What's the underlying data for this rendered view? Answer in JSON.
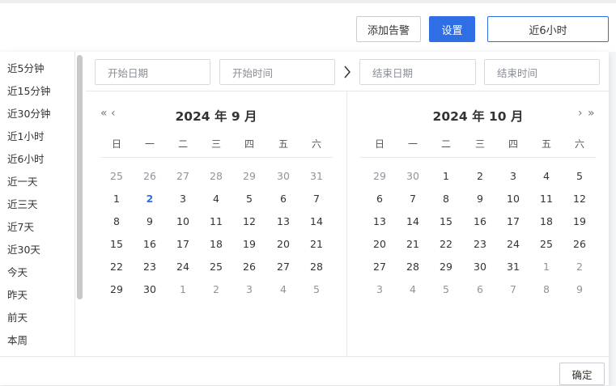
{
  "toolbar": {
    "add_alert_label": "添加告警",
    "settings_label": "设置",
    "range_label": "近6小时"
  },
  "sidebar": {
    "items": [
      "近5分钟",
      "近15分钟",
      "近30分钟",
      "近1小时",
      "近6小时",
      "近一天",
      "近三天",
      "近7天",
      "近30天",
      "今天",
      "昨天",
      "前天",
      "本周"
    ]
  },
  "inputs": {
    "start_date_placeholder": "开始日期",
    "start_time_placeholder": "开始时间",
    "end_date_placeholder": "结束日期",
    "end_time_placeholder": "结束时间"
  },
  "weekdays": [
    "日",
    "一",
    "二",
    "三",
    "四",
    "五",
    "六"
  ],
  "calendars": [
    {
      "title": "2024 年 9 月",
      "nav": [
        "«",
        "‹"
      ],
      "today": 2,
      "weeks": [
        [
          {
            "d": "25",
            "o": 1
          },
          {
            "d": "26",
            "o": 1
          },
          {
            "d": "27",
            "o": 1
          },
          {
            "d": "28",
            "o": 1
          },
          {
            "d": "29",
            "o": 1
          },
          {
            "d": "30",
            "o": 1
          },
          {
            "d": "31",
            "o": 1
          }
        ],
        [
          {
            "d": "1"
          },
          {
            "d": "2",
            "t": 1
          },
          {
            "d": "3"
          },
          {
            "d": "4"
          },
          {
            "d": "5"
          },
          {
            "d": "6"
          },
          {
            "d": "7"
          }
        ],
        [
          {
            "d": "8"
          },
          {
            "d": "9"
          },
          {
            "d": "10"
          },
          {
            "d": "11"
          },
          {
            "d": "12"
          },
          {
            "d": "13"
          },
          {
            "d": "14"
          }
        ],
        [
          {
            "d": "15"
          },
          {
            "d": "16"
          },
          {
            "d": "17"
          },
          {
            "d": "18"
          },
          {
            "d": "19"
          },
          {
            "d": "20"
          },
          {
            "d": "21"
          }
        ],
        [
          {
            "d": "22"
          },
          {
            "d": "23"
          },
          {
            "d": "24"
          },
          {
            "d": "25"
          },
          {
            "d": "26"
          },
          {
            "d": "27"
          },
          {
            "d": "28"
          }
        ],
        [
          {
            "d": "29"
          },
          {
            "d": "30"
          },
          {
            "d": "1",
            "o": 1
          },
          {
            "d": "2",
            "o": 1
          },
          {
            "d": "3",
            "o": 1
          },
          {
            "d": "4",
            "o": 1
          },
          {
            "d": "5",
            "o": 1
          }
        ]
      ]
    },
    {
      "title": "2024 年 10 月",
      "nav": [
        "›",
        "»"
      ],
      "weeks": [
        [
          {
            "d": "29",
            "o": 1
          },
          {
            "d": "30",
            "o": 1
          },
          {
            "d": "1"
          },
          {
            "d": "2"
          },
          {
            "d": "3"
          },
          {
            "d": "4"
          },
          {
            "d": "5"
          }
        ],
        [
          {
            "d": "6"
          },
          {
            "d": "7"
          },
          {
            "d": "8"
          },
          {
            "d": "9"
          },
          {
            "d": "10"
          },
          {
            "d": "11"
          },
          {
            "d": "12"
          }
        ],
        [
          {
            "d": "13"
          },
          {
            "d": "14"
          },
          {
            "d": "15"
          },
          {
            "d": "16"
          },
          {
            "d": "17"
          },
          {
            "d": "18"
          },
          {
            "d": "19"
          }
        ],
        [
          {
            "d": "20"
          },
          {
            "d": "21"
          },
          {
            "d": "22"
          },
          {
            "d": "23"
          },
          {
            "d": "24"
          },
          {
            "d": "25"
          },
          {
            "d": "26"
          }
        ],
        [
          {
            "d": "27"
          },
          {
            "d": "28"
          },
          {
            "d": "29"
          },
          {
            "d": "30"
          },
          {
            "d": "31"
          },
          {
            "d": "1",
            "o": 1
          },
          {
            "d": "2",
            "o": 1
          }
        ],
        [
          {
            "d": "3",
            "o": 1
          },
          {
            "d": "4",
            "o": 1
          },
          {
            "d": "5",
            "o": 1
          },
          {
            "d": "6",
            "o": 1
          },
          {
            "d": "7",
            "o": 1
          },
          {
            "d": "8",
            "o": 1
          },
          {
            "d": "9",
            "o": 1
          }
        ]
      ]
    }
  ],
  "footer": {
    "ok_label": "确定"
  },
  "colors": {
    "accent": "#2f6ee5",
    "border": "#e6e8eb",
    "muted_text": "#8f939b"
  }
}
